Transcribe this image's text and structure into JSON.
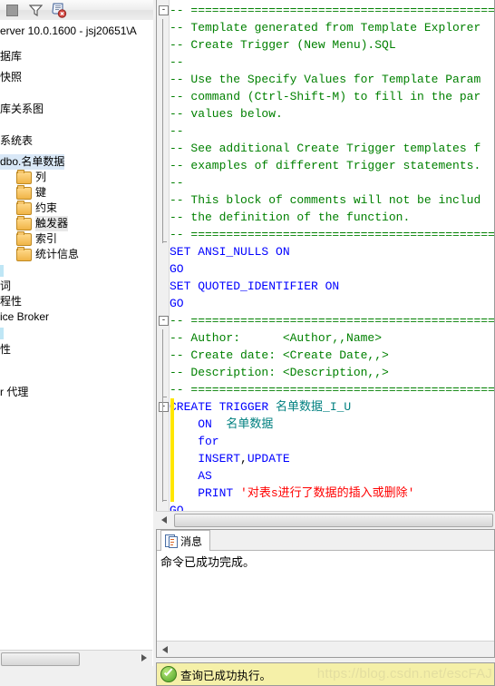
{
  "object_explorer": {
    "toolbar": [
      {
        "name": "stop-button",
        "label": "stop"
      },
      {
        "name": "filter-icon",
        "label": "filter"
      },
      {
        "name": "remove-filter-icon",
        "label": "remove filter"
      }
    ],
    "server_line": "erver 10.0.1600 - jsj20651\\A",
    "tree": [
      {
        "label": "据库",
        "indent": 0,
        "icon": "none",
        "style": "plain",
        "state": "normal"
      },
      {
        "label": "快照",
        "indent": 0,
        "icon": "none",
        "style": "plain",
        "state": "normal"
      },
      {
        "label": "库关系图",
        "indent": 0,
        "icon": "none",
        "style": "plain",
        "state": "normal"
      },
      {
        "label": "系统表",
        "indent": 0,
        "icon": "none",
        "style": "plain",
        "state": "normal"
      },
      {
        "label": "dbo.名单数据",
        "indent": 0,
        "icon": "none",
        "style": "plain",
        "state": "selected"
      },
      {
        "label": "列",
        "indent": 1,
        "icon": "folder",
        "style": "plain",
        "state": "normal"
      },
      {
        "label": "键",
        "indent": 1,
        "icon": "folder",
        "style": "plain",
        "state": "normal"
      },
      {
        "label": "约束",
        "indent": 1,
        "icon": "folder",
        "style": "plain",
        "state": "normal"
      },
      {
        "label": "触发器",
        "indent": 1,
        "icon": "folder",
        "style": "plain",
        "state": "highlight"
      },
      {
        "label": "索引",
        "indent": 1,
        "icon": "folder",
        "style": "plain",
        "state": "normal"
      },
      {
        "label": "统计信息",
        "indent": 1,
        "icon": "folder",
        "style": "plain",
        "state": "normal"
      },
      {
        "label": "",
        "indent": 0,
        "icon": "none",
        "style": "cyan",
        "state": "normal"
      },
      {
        "label": "词",
        "indent": 0,
        "icon": "none",
        "style": "plain",
        "state": "normal"
      },
      {
        "label": "程性",
        "indent": 0,
        "icon": "none",
        "style": "plain",
        "state": "normal"
      },
      {
        "label": "ice Broker",
        "indent": 0,
        "icon": "none",
        "style": "plain",
        "state": "normal"
      },
      {
        "label": "",
        "indent": 0,
        "icon": "none",
        "style": "cyan",
        "state": "normal"
      },
      {
        "label": "性",
        "indent": 0,
        "icon": "none",
        "style": "plain",
        "state": "normal"
      },
      {
        "label": "r 代理",
        "indent": 0,
        "icon": "none",
        "style": "plain",
        "state": "normal"
      }
    ]
  },
  "editor": {
    "lines": [
      {
        "fold": "open",
        "bar": "top",
        "segs": [
          {
            "t": "-- ==============================================",
            "c": "cmt"
          }
        ]
      },
      {
        "fold": "",
        "bar": "mid",
        "segs": [
          {
            "t": "-- Template generated from Template Explorer",
            "c": "cmt"
          }
        ]
      },
      {
        "fold": "",
        "bar": "mid",
        "segs": [
          {
            "t": "-- Create Trigger (New Menu).SQL",
            "c": "cmt"
          }
        ]
      },
      {
        "fold": "",
        "bar": "mid",
        "segs": [
          {
            "t": "--",
            "c": "cmt"
          }
        ]
      },
      {
        "fold": "",
        "bar": "mid",
        "segs": [
          {
            "t": "-- Use the Specify Values for Template Param",
            "c": "cmt"
          }
        ]
      },
      {
        "fold": "",
        "bar": "mid",
        "segs": [
          {
            "t": "-- command (Ctrl-Shift-M) to fill in the par",
            "c": "cmt"
          }
        ]
      },
      {
        "fold": "",
        "bar": "mid",
        "segs": [
          {
            "t": "-- values below.",
            "c": "cmt"
          }
        ]
      },
      {
        "fold": "",
        "bar": "mid",
        "segs": [
          {
            "t": "--",
            "c": "cmt"
          }
        ]
      },
      {
        "fold": "",
        "bar": "mid",
        "segs": [
          {
            "t": "-- See additional Create Trigger templates f",
            "c": "cmt"
          }
        ]
      },
      {
        "fold": "",
        "bar": "mid",
        "segs": [
          {
            "t": "-- examples of different Trigger statements.",
            "c": "cmt"
          }
        ]
      },
      {
        "fold": "",
        "bar": "mid",
        "segs": [
          {
            "t": "--",
            "c": "cmt"
          }
        ]
      },
      {
        "fold": "",
        "bar": "mid",
        "segs": [
          {
            "t": "-- This block of comments will not be includ",
            "c": "cmt"
          }
        ]
      },
      {
        "fold": "",
        "bar": "mid",
        "segs": [
          {
            "t": "-- the definition of the function.",
            "c": "cmt"
          }
        ]
      },
      {
        "fold": "",
        "bar": "end",
        "segs": [
          {
            "t": "-- ==============================================",
            "c": "cmt"
          }
        ]
      },
      {
        "fold": "",
        "bar": "",
        "segs": [
          {
            "t": "SET ANSI_NULLS ON",
            "c": "kw"
          }
        ]
      },
      {
        "fold": "",
        "bar": "",
        "segs": [
          {
            "t": "GO",
            "c": "kw"
          }
        ]
      },
      {
        "fold": "",
        "bar": "",
        "segs": [
          {
            "t": "SET QUOTED_IDENTIFIER ON",
            "c": "kw"
          }
        ]
      },
      {
        "fold": "",
        "bar": "",
        "segs": [
          {
            "t": "GO",
            "c": "kw"
          }
        ]
      },
      {
        "fold": "open",
        "bar": "top",
        "segs": [
          {
            "t": "-- ==============================================",
            "c": "cmt"
          }
        ]
      },
      {
        "fold": "",
        "bar": "mid",
        "segs": [
          {
            "t": "-- Author:      <Author,,Name>",
            "c": "cmt"
          }
        ]
      },
      {
        "fold": "",
        "bar": "mid",
        "segs": [
          {
            "t": "-- Create date: <Create Date,,>",
            "c": "cmt"
          }
        ]
      },
      {
        "fold": "",
        "bar": "mid",
        "segs": [
          {
            "t": "-- Description: <Description,,>",
            "c": "cmt"
          }
        ]
      },
      {
        "fold": "",
        "bar": "end",
        "segs": [
          {
            "t": "-- ==============================================",
            "c": "cmt"
          }
        ]
      },
      {
        "fold": "open",
        "bar": "ytop",
        "segs": [
          {
            "t": "CREATE TRIGGER ",
            "c": "kw"
          },
          {
            "t": "名单数据_I_U",
            "c": "id"
          }
        ]
      },
      {
        "fold": "",
        "bar": "ymid",
        "segs": [
          {
            "t": "    ON  ",
            "c": "kw"
          },
          {
            "t": "名单数据",
            "c": "id"
          }
        ]
      },
      {
        "fold": "",
        "bar": "ymid",
        "segs": [
          {
            "t": "    for",
            "c": "kw"
          }
        ]
      },
      {
        "fold": "",
        "bar": "ymid",
        "segs": [
          {
            "t": "    INSERT",
            "c": "kw"
          },
          {
            "t": ",",
            "c": "plain"
          },
          {
            "t": "UPDATE",
            "c": "kw"
          }
        ]
      },
      {
        "fold": "",
        "bar": "ymid",
        "segs": [
          {
            "t": "    AS",
            "c": "kw"
          }
        ]
      },
      {
        "fold": "",
        "bar": "yend",
        "segs": [
          {
            "t": "    PRINT ",
            "c": "kw"
          },
          {
            "t": "'对表s进行了数据的插入或删除'",
            "c": "str"
          }
        ]
      },
      {
        "fold": "",
        "bar": "",
        "segs": [
          {
            "t": "GO",
            "c": "kw"
          }
        ]
      }
    ]
  },
  "results": {
    "tab_label": "消息",
    "tab_icon": "messages-icon",
    "message": "命令已成功完成。"
  },
  "statusbar": {
    "icon": "success-check-icon",
    "text": "查询已成功执行。",
    "watermark": "https://blog.csdn.net/escFAJ"
  }
}
